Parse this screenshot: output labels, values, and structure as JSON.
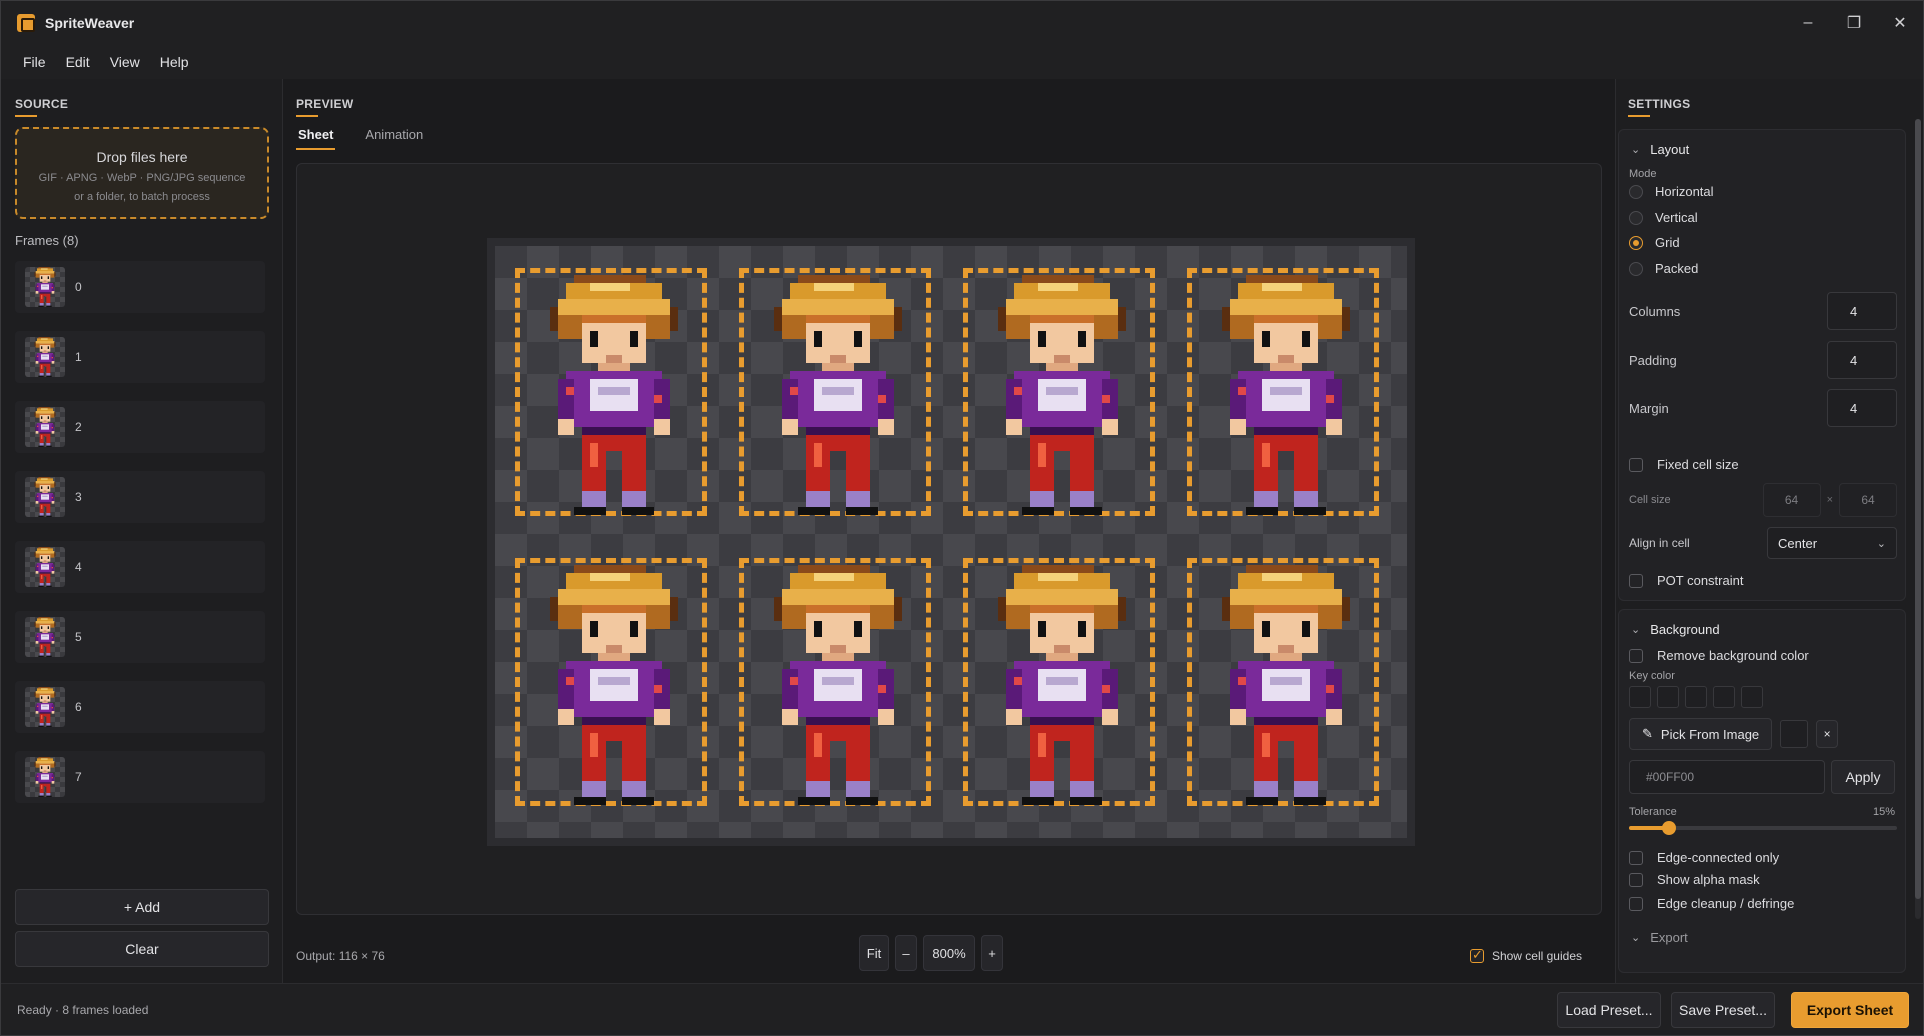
{
  "app": {
    "title": "SpriteWeaver"
  },
  "window_controls": {
    "minimize": "–",
    "restore": "❐",
    "close": "✕"
  },
  "menu": [
    "File",
    "Edit",
    "View",
    "Help"
  ],
  "source": {
    "label": "SOURCE",
    "dropzone": {
      "title": "Drop files here",
      "line1": "GIF · APNG · WebP · PNG/JPG sequence",
      "line2": "or a folder, to batch process"
    },
    "frames_label": "Frames (8)",
    "frames": [
      "0",
      "1",
      "2",
      "3",
      "4",
      "5",
      "6",
      "7"
    ],
    "add_label": "+ Add",
    "clear_label": "Clear"
  },
  "preview": {
    "label": "PREVIEW",
    "tabs": [
      {
        "label": "Sheet",
        "active": true
      },
      {
        "label": "Animation",
        "active": false
      }
    ],
    "output": "Output: 116 × 76",
    "zoom": {
      "fit": "Fit",
      "minus": "–",
      "value": "800%",
      "plus": "+"
    },
    "show_guides": {
      "label": "Show cell guides",
      "checked": true
    },
    "grid": {
      "columns": 4,
      "rows": 2,
      "frame_count": 8
    }
  },
  "settings": {
    "label": "SETTINGS",
    "layout": {
      "header": "Layout",
      "mode_label": "Mode",
      "modes": [
        {
          "label": "Horizontal",
          "selected": false
        },
        {
          "label": "Vertical",
          "selected": false
        },
        {
          "label": "Grid",
          "selected": true
        },
        {
          "label": "Packed",
          "selected": false
        }
      ],
      "columns_label": "Columns",
      "columns": "4",
      "padding_label": "Padding",
      "padding": "4",
      "margin_label": "Margin",
      "margin": "4",
      "fixed_cell_label": "Fixed cell size",
      "cell_size_label": "Cell size",
      "cell_w": "64",
      "cell_x": "×",
      "cell_h": "64",
      "align_label": "Align in cell",
      "align_value": "Center",
      "pot_label": "POT constraint"
    },
    "background": {
      "header": "Background",
      "remove_label": "Remove background color",
      "key_color_label": "Key color",
      "pick_label": "Pick From Image",
      "clear_x": "×",
      "hex_placeholder": "#00FF00",
      "apply_label": "Apply",
      "tolerance_label": "Tolerance",
      "tolerance_value": "15%",
      "tolerance": 0.15,
      "edge_label": "Edge-connected only",
      "alpha_label": "Show alpha mask",
      "cleanup_label": "Edge cleanup / defringe"
    },
    "export_header": "Export"
  },
  "status": {
    "text": "Ready · 8 frames loaded",
    "load_label": "Load Preset...",
    "save_label": "Save Preset...",
    "export_label": "Export Sheet"
  },
  "colors": {
    "accent": "#e89c2f",
    "bg": "#1b1b1d",
    "panel": "#1e1e20"
  },
  "icons": {
    "pick": "eyedropper-icon",
    "chevron": "chevron-down-icon"
  }
}
